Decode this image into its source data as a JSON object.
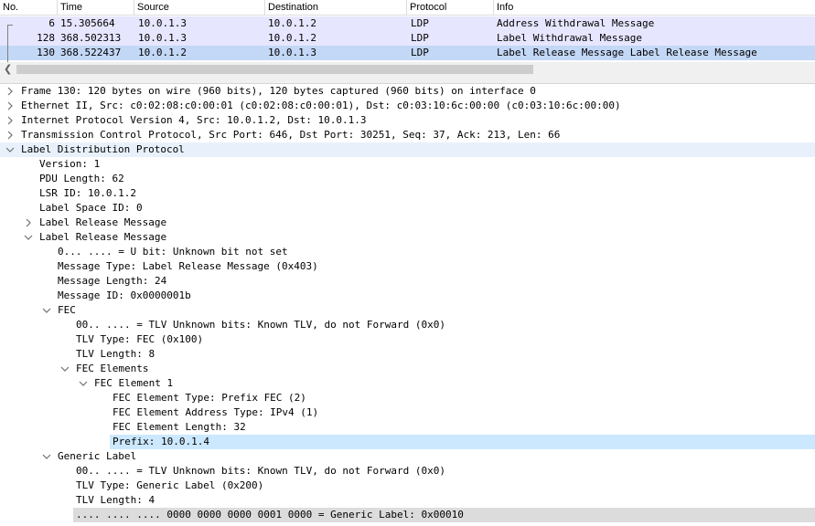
{
  "packet_list": {
    "columns": [
      "No.",
      "Time",
      "Source",
      "Destination",
      "Protocol",
      "Info"
    ],
    "rows": [
      {
        "no": "6",
        "time": "15.305664",
        "source": "10.0.1.3",
        "destination": "10.0.1.2",
        "protocol": "LDP",
        "info": "Address Withdrawal Message",
        "selected": false
      },
      {
        "no": "128",
        "time": "368.502313",
        "source": "10.0.1.3",
        "destination": "10.0.1.2",
        "protocol": "LDP",
        "info": "Label Withdrawal Message",
        "selected": false
      },
      {
        "no": "130",
        "time": "368.522437",
        "source": "10.0.1.2",
        "destination": "10.0.1.3",
        "protocol": "LDP",
        "info": "Label Release Message Label Release Message",
        "selected": true
      }
    ],
    "colors": {
      "row_bg": "#e7e6ff",
      "selected_bg": "#c3d7f6"
    }
  },
  "details": {
    "lines": [
      {
        "text": "Frame 130: 120 bytes on wire (960 bits), 120 bytes captured (960 bits) on interface 0",
        "depth": 0,
        "toggle": "collapsed"
      },
      {
        "text": "Ethernet II, Src: c0:02:08:c0:00:01 (c0:02:08:c0:00:01), Dst: c0:03:10:6c:00:00 (c0:03:10:6c:00:00)",
        "depth": 0,
        "toggle": "collapsed"
      },
      {
        "text": "Internet Protocol Version 4, Src: 10.0.1.2, Dst: 10.0.1.3",
        "depth": 0,
        "toggle": "collapsed"
      },
      {
        "text": "Transmission Control Protocol, Src Port: 646, Dst Port: 30251, Seq: 37, Ack: 213, Len: 66",
        "depth": 0,
        "toggle": "collapsed"
      },
      {
        "text": "Label Distribution Protocol",
        "depth": 0,
        "toggle": "expanded",
        "style": "hl"
      },
      {
        "text": "Version: 1",
        "depth": 1,
        "toggle": "none"
      },
      {
        "text": "PDU Length: 62",
        "depth": 1,
        "toggle": "none"
      },
      {
        "text": "LSR ID: 10.0.1.2",
        "depth": 1,
        "toggle": "none"
      },
      {
        "text": "Label Space ID: 0",
        "depth": 1,
        "toggle": "none"
      },
      {
        "text": "Label Release Message",
        "depth": 1,
        "toggle": "collapsed"
      },
      {
        "text": "Label Release Message",
        "depth": 1,
        "toggle": "expanded"
      },
      {
        "text": "0... .... = U bit: Unknown bit not set",
        "depth": 2,
        "toggle": "none"
      },
      {
        "text": "Message Type: Label Release Message (0x403)",
        "depth": 2,
        "toggle": "none"
      },
      {
        "text": "Message Length: 24",
        "depth": 2,
        "toggle": "none"
      },
      {
        "text": "Message ID: 0x0000001b",
        "depth": 2,
        "toggle": "none"
      },
      {
        "text": "FEC",
        "depth": 2,
        "toggle": "expanded"
      },
      {
        "text": "00.. .... = TLV Unknown bits: Known TLV, do not Forward (0x0)",
        "depth": 3,
        "toggle": "none"
      },
      {
        "text": "TLV Type: FEC (0x100)",
        "depth": 3,
        "toggle": "none"
      },
      {
        "text": "TLV Length: 8",
        "depth": 3,
        "toggle": "none"
      },
      {
        "text": "FEC Elements",
        "depth": 3,
        "toggle": "expanded"
      },
      {
        "text": "FEC Element 1",
        "depth": 4,
        "toggle": "expanded"
      },
      {
        "text": "FEC Element Type: Prefix FEC (2)",
        "depth": 5,
        "toggle": "none"
      },
      {
        "text": "FEC Element Address Type: IPv4 (1)",
        "depth": 5,
        "toggle": "none"
      },
      {
        "text": "FEC Element Length: 32",
        "depth": 5,
        "toggle": "none"
      },
      {
        "text": "Prefix: 10.0.1.4",
        "depth": 5,
        "toggle": "none",
        "style": "sel"
      },
      {
        "text": "Generic Label",
        "depth": 2,
        "toggle": "expanded"
      },
      {
        "text": "00.. .... = TLV Unknown bits: Known TLV, do not Forward (0x0)",
        "depth": 3,
        "toggle": "none"
      },
      {
        "text": "TLV Type: Generic Label (0x200)",
        "depth": 3,
        "toggle": "none"
      },
      {
        "text": "TLV Length: 4",
        "depth": 3,
        "toggle": "none"
      },
      {
        "text": ".... .... .... 0000 0000 0000 0001 0000 = Generic Label: 0x00010",
        "depth": 3,
        "toggle": "none",
        "style": "gray"
      }
    ]
  }
}
